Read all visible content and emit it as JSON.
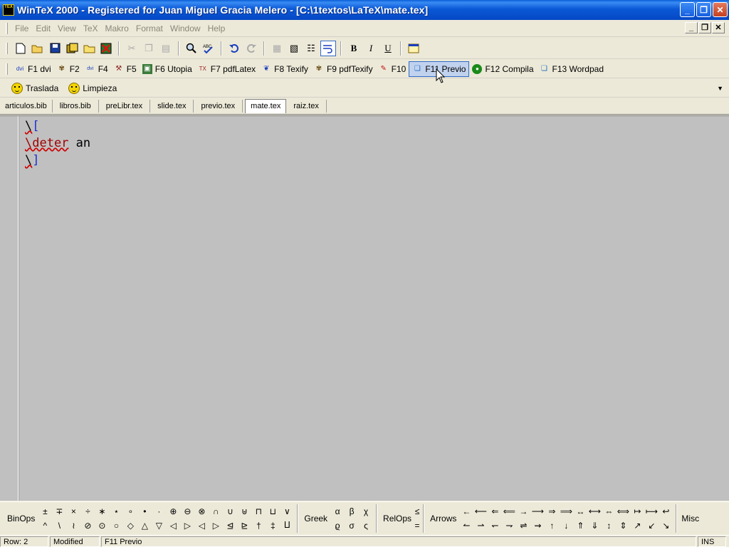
{
  "window": {
    "title": "WinTeX 2000 - Registered for Juan Miguel Gracia Melero - [C:\\1textos\\LaTeX\\mate.tex]",
    "app_icon_text": "TEX",
    "minimize_glyph": "_",
    "maximize_glyph": "❐",
    "close_glyph": "✕"
  },
  "menu": {
    "items": [
      "File",
      "Edit",
      "View",
      "TeX",
      "Makro",
      "Format",
      "Window",
      "Help"
    ],
    "mdi_minimize": "_",
    "mdi_restore": "❐",
    "mdi_close": "✕"
  },
  "toolbar": {
    "icons": [
      "new-file-icon",
      "open-file-icon",
      "save-icon",
      "save-all-icon",
      "folder-icon",
      "close-file-icon",
      "cut-icon",
      "copy-icon",
      "paste-icon",
      "find-icon",
      "spellcheck-icon",
      "undo-icon",
      "redo-icon",
      "macro1-icon",
      "macro2-icon",
      "macro3-icon",
      "wordwrap-icon",
      "calendar-icon"
    ],
    "bold": "B",
    "italic": "I",
    "underline": "U"
  },
  "fkeys": [
    {
      "label": "F1 dvi",
      "icon": "dvi-icon"
    },
    {
      "label": "F2",
      "icon": "bug-icon"
    },
    {
      "label": "F4",
      "icon": "dvips-icon"
    },
    {
      "label": "F5",
      "icon": "tool-icon"
    },
    {
      "label": "F6 Utopia",
      "icon": "image-icon"
    },
    {
      "label": "F7 pdfLatex",
      "icon": "pdflatex-icon"
    },
    {
      "label": "F8 Texify",
      "icon": "texify-icon"
    },
    {
      "label": "F9 pdfTexify",
      "icon": "pdftexify-icon"
    },
    {
      "label": "F10",
      "icon": "acrobat-icon"
    },
    {
      "label": "F11 Previo",
      "icon": "preview-icon"
    },
    {
      "label": "F12 Compila",
      "icon": "compile-icon"
    },
    {
      "label": "F13 Wordpad",
      "icon": "wordpad-icon"
    }
  ],
  "macros": [
    {
      "label": "Traslada",
      "icon": "smiley-icon"
    },
    {
      "label": "Limpieza",
      "icon": "smiley-icon"
    }
  ],
  "tabs": [
    "articulos.bib",
    "libros.bib",
    "preLibr.tex",
    "slide.tex",
    "previo.tex",
    "mate.tex",
    "raiz.tex"
  ],
  "active_tab": "mate.tex",
  "editor": {
    "lines": [
      {
        "bs": "\\",
        "rest": "[",
        "kind": "bracket"
      },
      {
        "bs": "\\deter",
        "rest": " an",
        "kind": "command"
      },
      {
        "bs": "\\",
        "rest": "]",
        "kind": "bracket"
      }
    ]
  },
  "palette": {
    "binops_label": "BinOps",
    "binops": [
      "±",
      "^",
      "∓",
      "\\",
      "×",
      "≀",
      "÷",
      "⊘",
      "∗",
      "⊙",
      "⋆",
      "○",
      "∘",
      "◇",
      "•",
      "△",
      "·",
      "▽",
      "⊕",
      "◁",
      "⊖",
      "▷",
      "⊗",
      "◁",
      "∩",
      "▷",
      "∪",
      "⊴",
      "⊎",
      "⊵",
      "⊓",
      "†",
      "⊔",
      "‡",
      "∨",
      "⨿"
    ],
    "greek_label": "Greek",
    "greek": [
      "α",
      "ϱ",
      "β",
      "σ",
      "χ",
      "ς"
    ],
    "relops_label": "RelOps",
    "relops": [
      "≤",
      "="
    ],
    "arrows_label": "Arrows",
    "arrows": [
      "←",
      "↼",
      "⟵",
      "⇀",
      "⇐",
      "↽",
      "⟸",
      "⇁",
      "→",
      "⇌",
      "⟶",
      "⇝",
      "⇒",
      "↑",
      "⟹",
      "↓",
      "↔",
      "⇑",
      "⟷",
      "⇓",
      "⇔",
      "↕",
      "⟺",
      "⇕",
      "↦",
      "↗",
      "⟼",
      "↙",
      "↩",
      "↘"
    ],
    "misc_label": "Misc"
  },
  "status": {
    "row": "Row: 2",
    "modified": "Modified",
    "action": "F11 Previo",
    "mode": "INS"
  }
}
